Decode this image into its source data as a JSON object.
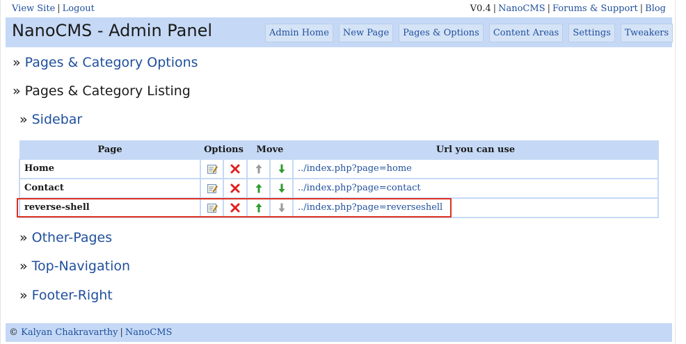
{
  "topbar": {
    "view_site": "View Site",
    "logout": "Logout",
    "version": "V0.4",
    "nanocms": "NanoCMS",
    "forums": "Forums & Support",
    "blog": "Blog"
  },
  "header": {
    "title": "NanoCMS - Admin Panel",
    "nav": [
      "Admin Home",
      "New Page",
      "Pages & Options",
      "Content Areas",
      "Settings",
      "Tweakers"
    ]
  },
  "sections": {
    "options": "Pages & Category Options",
    "listing": "Pages & Category Listing",
    "sidebar": "Sidebar",
    "other": "Other-Pages",
    "top_nav": "Top-Navigation",
    "footer_right": "Footer-Right"
  },
  "table": {
    "headers": [
      "Page",
      "Options",
      "Move",
      "Url you can use"
    ],
    "rows": [
      {
        "name": "Home",
        "url": "../index.php?page=home",
        "up_enabled": false,
        "down_enabled": true
      },
      {
        "name": "Contact",
        "url": "../index.php?page=contact",
        "up_enabled": true,
        "down_enabled": true
      },
      {
        "name": "reverse-shell",
        "url": "../index.php?page=reverseshell",
        "up_enabled": true,
        "down_enabled": false
      }
    ]
  },
  "footer": {
    "copyright": "©",
    "author": "Kalyan Chakravarthy",
    "nanocms": "NanoCMS"
  },
  "colors": {
    "header_bg": "#c5d9f6",
    "link": "#1f4f9c",
    "highlight": "#e0301e",
    "arrow_enabled": "#2e9b2e",
    "arrow_disabled": "#9a9a9a",
    "delete": "#e02020"
  },
  "icons": {
    "edit": "edit-icon",
    "delete": "delete-icon",
    "up": "arrow-up-icon",
    "down": "arrow-down-icon"
  }
}
